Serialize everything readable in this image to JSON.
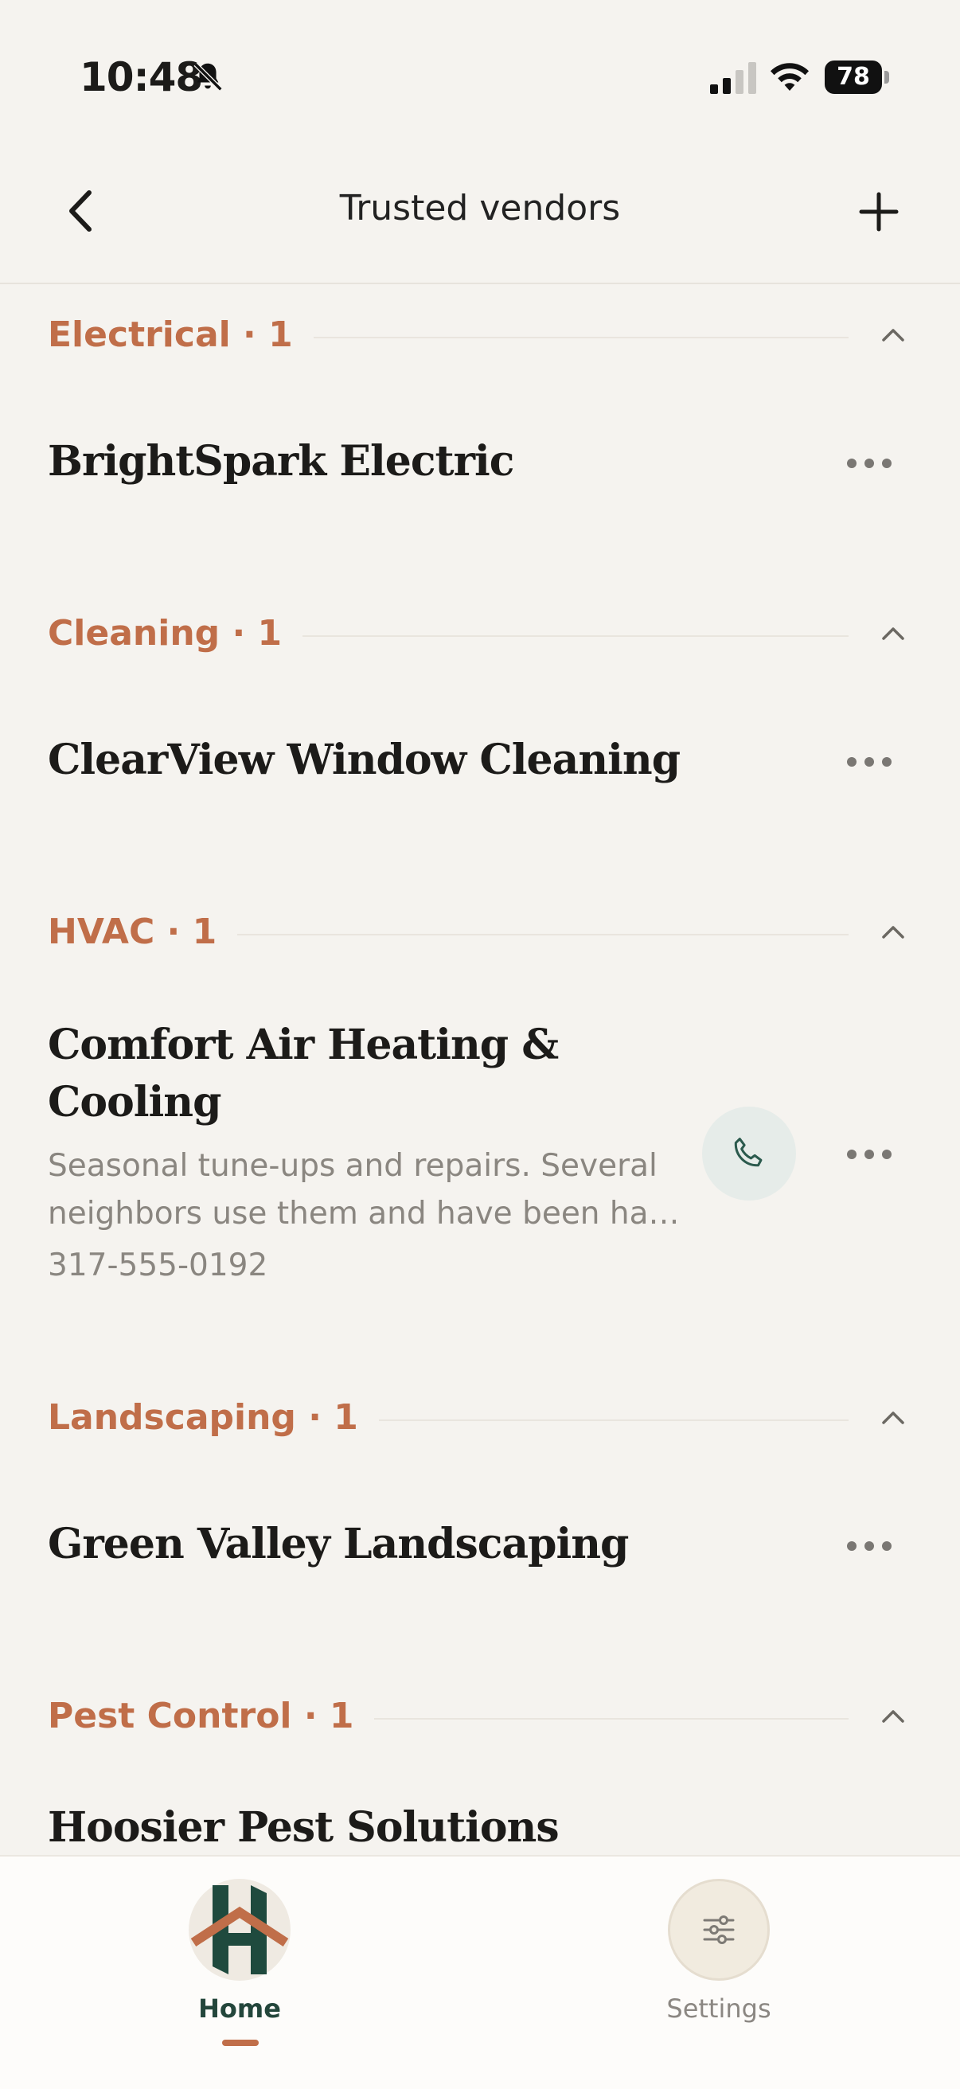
{
  "status_bar": {
    "time": "10:48",
    "battery": "78"
  },
  "nav": {
    "title": "Trusted vendors"
  },
  "sections": [
    {
      "label": "Electrical · 1",
      "vendors": [
        {
          "name": "BrightSpark Electric"
        }
      ]
    },
    {
      "label": "Cleaning · 1",
      "vendors": [
        {
          "name": "ClearView Window Cleaning"
        }
      ]
    },
    {
      "label": "HVAC · 1",
      "vendors": [
        {
          "name_line1": "Comfort Air Heating &",
          "name_line2": "Cooling",
          "desc_line1": "Seasonal tune-ups and repairs. Several",
          "desc_line2": "neighbors use them and have been ha…",
          "phone": "317-555-0192"
        }
      ]
    },
    {
      "label": "Landscaping · 1",
      "vendors": [
        {
          "name": "Green Valley Landscaping"
        }
      ]
    },
    {
      "label": "Pest Control · 1",
      "vendors": [
        {
          "name": "Hoosier Pest Solutions"
        }
      ]
    }
  ],
  "tabs": {
    "home": "Home",
    "settings": "Settings"
  },
  "colors": {
    "accent": "#c06e49",
    "brand_green": "#23463b",
    "background": "#f5f3ef"
  },
  "icons": [
    "bell-slash-icon",
    "signal-icon",
    "wifi-icon",
    "battery-icon",
    "chevron-left-icon",
    "plus-icon",
    "chevron-up-icon",
    "more-icon",
    "phone-icon",
    "home-logo-icon",
    "sliders-icon"
  ]
}
